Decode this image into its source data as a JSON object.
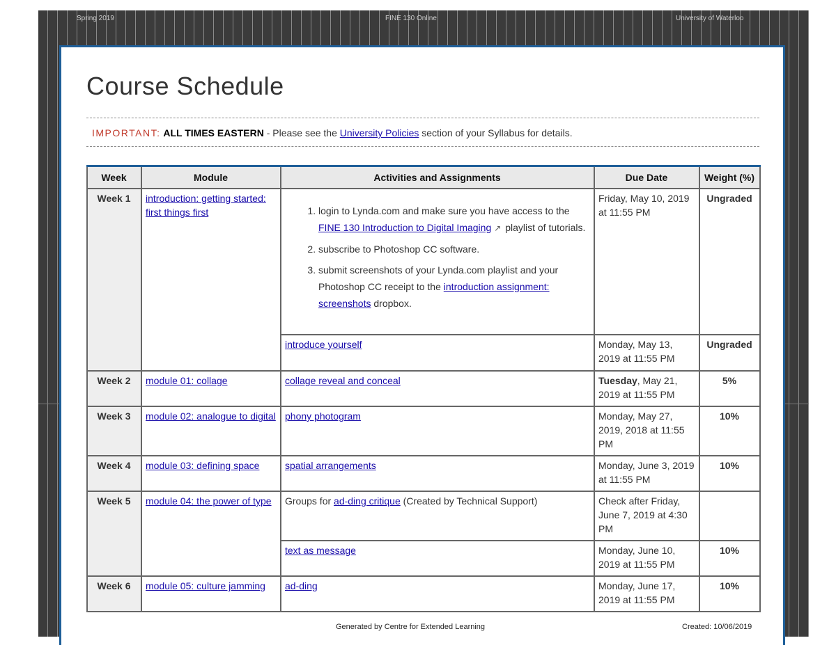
{
  "header": {
    "left": "Spring 2019",
    "center": "FINE 130 Online",
    "right": "University of Waterloo"
  },
  "page": {
    "title": "Course Schedule"
  },
  "notice": {
    "important": "IMPORTANT:",
    "bold": "ALL TIMES EASTERN",
    "pre_link": " - Please see the ",
    "link": "University Policies",
    "post_link": " section of your Syllabus for details."
  },
  "table": {
    "headers": {
      "week": "Week",
      "module": "Module",
      "activities": "Activities and Assignments",
      "due": "Due Date",
      "weight": "Weight (%)"
    },
    "week1": {
      "week": "Week 1",
      "module": "introduction: getting started: first things first",
      "item1_pre": "login to Lynda.com and make sure you have access to the ",
      "item1_link": "FINE 130 Introduction to Digital Imaging",
      "item1_post": " playlist of tutorials.",
      "item2": "subscribe to Photoshop CC software.",
      "item3_pre": "submit screenshots of your Lynda.com playlist and your Photoshop CC receipt to the ",
      "item3_link": "introduction assignment: screenshots",
      "item3_post": " dropbox.",
      "due1": "Friday, May 10, 2019 at 11:55 PM",
      "weight1": "Ungraded",
      "activity2": "introduce yourself",
      "due2": "Monday, May 13, 2019 at 11:55 PM",
      "weight2": "Ungraded"
    },
    "week2": {
      "week": "Week 2",
      "module": "module 01: collage",
      "activity": "collage reveal and conceal",
      "due_bold": "Tuesday",
      "due_rest": ", May 21, 2019 at 11:55 PM",
      "weight": "5%"
    },
    "week3": {
      "week": "Week 3",
      "module": "module 02: analogue to digital",
      "activity": "phony photogram",
      "due": "Monday, May 27, 2019, 2018 at 11:55 PM",
      "weight": "10%"
    },
    "week4": {
      "week": "Week 4",
      "module": "module 03: defining space",
      "activity": "spatial arrangements",
      "due": "Monday, June 3, 2019 at 11:55 PM",
      "weight": "10%"
    },
    "week5": {
      "week": "Week 5",
      "module": "module 04: the power of type",
      "groups_pre": "Groups for ",
      "groups_link": "ad-ding critique",
      "groups_post": " (Created by Technical Support)",
      "due1": "Check after Friday, June 7, 2019 at 4:30 PM",
      "weight1": "",
      "activity2": "text as message",
      "due2": "Monday, June 10, 2019 at 11:55 PM",
      "weight2": "10%"
    },
    "week6": {
      "week": "Week 6",
      "module": "module 05: culture jamming",
      "activity": "ad-ding",
      "due": "Monday, June 17, 2019 at 11:55 PM",
      "weight": "10%"
    }
  },
  "footer": {
    "center": "Generated by Centre for Extended Learning",
    "right": "Created: 10/06/2019"
  },
  "colors": {
    "frame": "#3b3b3b",
    "panel_border": "#1f5f99",
    "important": "#c0392b",
    "link": "#1a0dab"
  },
  "icons": {
    "external_link": "external-link-icon"
  }
}
